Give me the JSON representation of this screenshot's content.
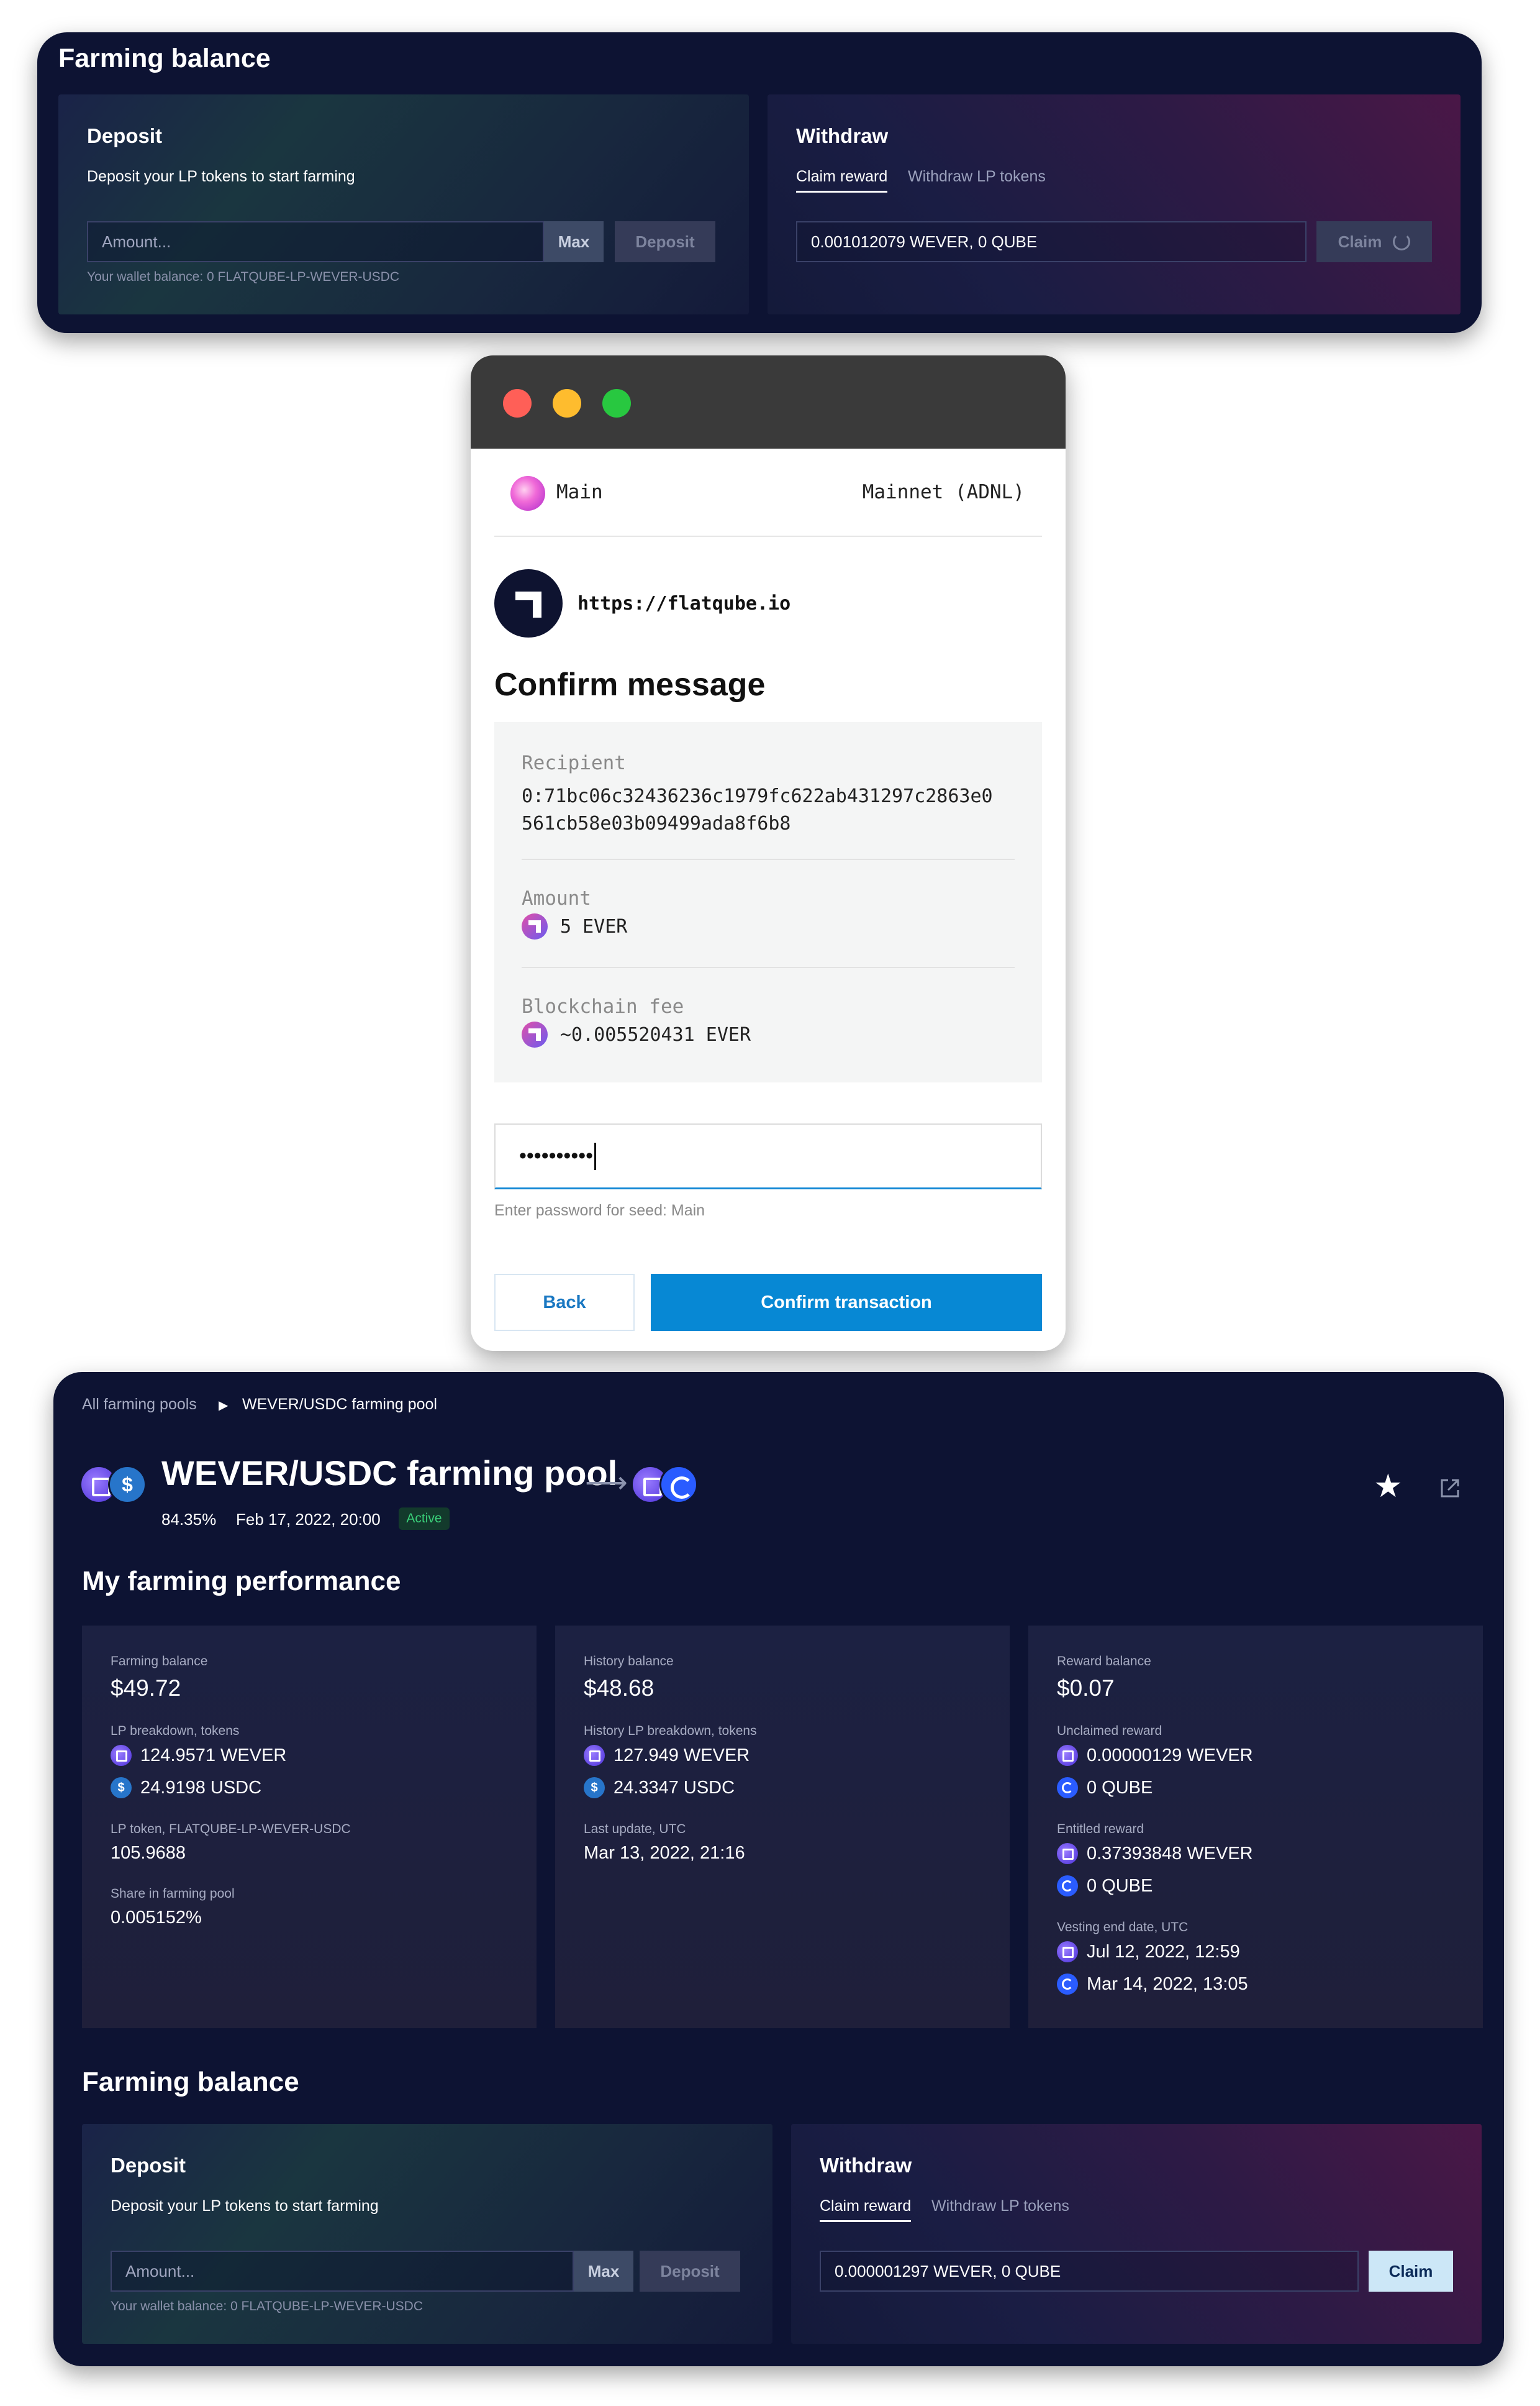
{
  "panel1": {
    "title": "Farming balance",
    "deposit": {
      "title": "Deposit",
      "subtitle": "Deposit your LP tokens to start farming",
      "amount_placeholder": "Amount...",
      "max_label": "Max",
      "deposit_label": "Deposit",
      "wallet_balance": "Your wallet balance: 0 FLATQUBE-LP-WEVER-USDC"
    },
    "withdraw": {
      "title": "Withdraw",
      "tabs": [
        "Claim reward",
        "Withdraw LP tokens"
      ],
      "reward_value": "0.001012079 WEVER, 0 QUBE",
      "claim_label": "Claim"
    }
  },
  "modal": {
    "account": "Main",
    "network": "Mainnet (ADNL)",
    "site_url": "https://flatqube.io",
    "title": "Confirm message",
    "recipient_label": "Recipient",
    "recipient_line1": "0:71bc06c32436236c1979fc622ab431297c2863e0",
    "recipient_line2": "561cb58e03b09499ada8f6b8",
    "amount_label": "Amount",
    "amount_value": "5 EVER",
    "fee_label": "Blockchain fee",
    "fee_value": "~0.005520431 EVER",
    "password_mask": "••••••••••",
    "password_hint": "Enter password for seed: Main",
    "back_label": "Back",
    "confirm_label": "Confirm transaction"
  },
  "pool": {
    "breadcrumb_root": "All farming pools",
    "breadcrumb_current": "WEVER/USDC farming pool",
    "title": "WEVER/USDC farming pool",
    "apr": "84.35%",
    "date": "Feb 17, 2022, 20:00",
    "status": "Active",
    "performance_title": "My farming performance",
    "farming": {
      "balance_label": "Farming balance",
      "balance_value": "$49.72",
      "lp_breakdown_label": "LP breakdown, tokens",
      "wever": "124.9571 WEVER",
      "usdc": "24.9198 USDC",
      "lp_token_label": "LP token, FLATQUBE-LP-WEVER-USDC",
      "lp_token_value": "105.9688",
      "share_label": "Share in farming pool",
      "share_value": "0.005152%"
    },
    "history": {
      "balance_label": "History balance",
      "balance_value": "$48.68",
      "lp_breakdown_label": "History LP breakdown, tokens",
      "wever": "127.949 WEVER",
      "usdc": "24.3347 USDC",
      "update_label": "Last update, UTC",
      "update_value": "Mar 13, 2022, 21:16"
    },
    "reward": {
      "balance_label": "Reward balance",
      "balance_value": "$0.07",
      "unclaimed_label": "Unclaimed reward",
      "unclaimed_wever": "0.00000129 WEVER",
      "unclaimed_qube": "0 QUBE",
      "entitled_label": "Entitled reward",
      "entitled_wever": "0.37393848 WEVER",
      "entitled_qube": "0 QUBE",
      "vesting_label": "Vesting end date, UTC",
      "vesting_wever": "Jul 12, 2022, 12:59",
      "vesting_qube": "Mar 14, 2022, 13:05"
    },
    "farming_balance_title": "Farming balance",
    "deposit": {
      "title": "Deposit",
      "subtitle": "Deposit your LP tokens to start farming",
      "amount_placeholder": "Amount...",
      "max_label": "Max",
      "deposit_label": "Deposit",
      "wallet_balance": "Your wallet balance: 0 FLATQUBE-LP-WEVER-USDC"
    },
    "withdraw": {
      "title": "Withdraw",
      "tabs": [
        "Claim reward",
        "Withdraw LP tokens"
      ],
      "reward_value": "0.000001297 WEVER, 0 QUBE",
      "claim_label": "Claim"
    }
  },
  "colors": {
    "panel_bg": "#0d1333",
    "confirm_blue": "#0788d4",
    "active_green": "#3ad17a",
    "claim_enabled_bg": "#cce7f7"
  }
}
